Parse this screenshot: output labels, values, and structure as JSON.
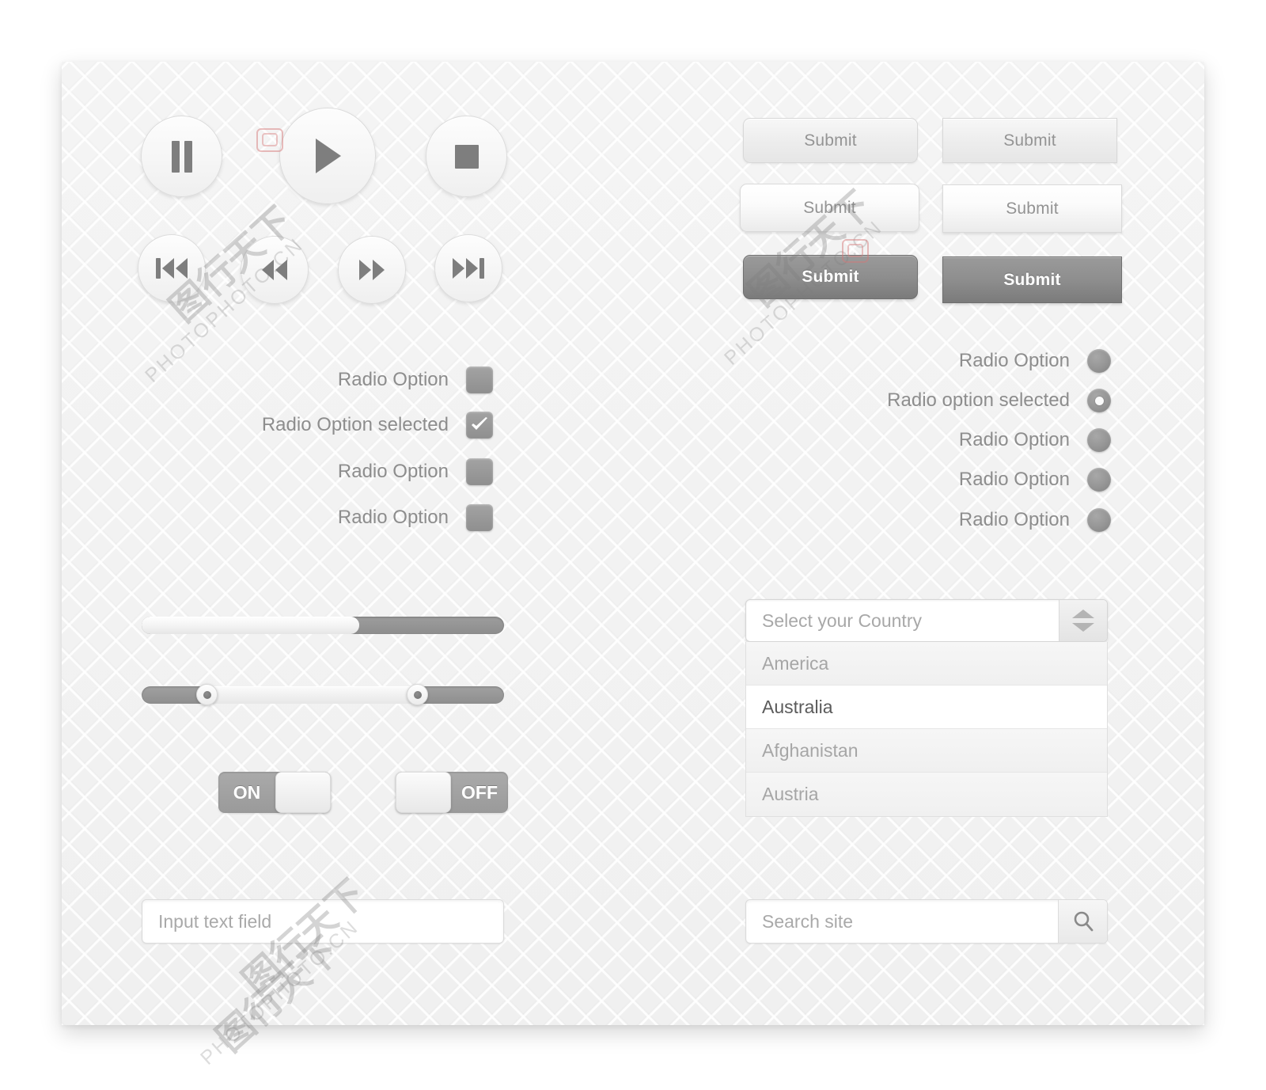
{
  "panel": {
    "background_color": "#f1f1f1",
    "accent_gray": "#8e8e8e",
    "text_gray": "#8d8d8d"
  },
  "media_controls": {
    "buttons": [
      {
        "name": "pause-button",
        "icon": "pause-icon"
      },
      {
        "name": "play-button",
        "icon": "play-icon"
      },
      {
        "name": "stop-button",
        "icon": "stop-icon"
      },
      {
        "name": "skip-back-button",
        "icon": "skip-back-icon"
      },
      {
        "name": "rewind-button",
        "icon": "rewind-icon"
      },
      {
        "name": "fast-forward-button",
        "icon": "fast-forward-icon"
      },
      {
        "name": "skip-forward-button",
        "icon": "skip-forward-icon"
      }
    ]
  },
  "submit_buttons": [
    {
      "label": "Submit",
      "style": "light-flat",
      "shape": "rounded"
    },
    {
      "label": "Submit",
      "style": "light-flat",
      "shape": "square"
    },
    {
      "label": "Submit",
      "style": "light-glossy",
      "shape": "rounded"
    },
    {
      "label": "Submit",
      "style": "light-glossy",
      "shape": "square"
    },
    {
      "label": "Submit",
      "style": "dark",
      "shape": "rounded"
    },
    {
      "label": "Submit",
      "style": "dark",
      "shape": "square"
    }
  ],
  "checkbox_group": {
    "items": [
      {
        "label": "Radio Option",
        "checked": false
      },
      {
        "label": "Radio Option selected",
        "checked": true
      },
      {
        "label": "Radio Option",
        "checked": false
      },
      {
        "label": "Radio Option",
        "checked": false
      }
    ]
  },
  "radio_group": {
    "items": [
      {
        "label": "Radio Option",
        "selected": false
      },
      {
        "label": "Radio option selected",
        "selected": true
      },
      {
        "label": "Radio Option",
        "selected": false
      },
      {
        "label": "Radio Option",
        "selected": false
      },
      {
        "label": "Radio Option",
        "selected": false
      }
    ]
  },
  "progress_bar": {
    "percent": 60
  },
  "range_slider": {
    "low_percent": 18,
    "high_percent": 76
  },
  "toggles": [
    {
      "label": "ON",
      "state": "on",
      "knob_side": "right"
    },
    {
      "label": "OFF",
      "state": "off",
      "knob_side": "left"
    }
  ],
  "text_input": {
    "placeholder": "Input text field",
    "value": ""
  },
  "search": {
    "placeholder": "Search site",
    "value": "",
    "icon": "search-icon"
  },
  "select": {
    "placeholder": "Select your Country",
    "value": "",
    "stepper_icon": "stepper-updown-icon",
    "options": [
      {
        "label": "America",
        "selected": false
      },
      {
        "label": "Australia",
        "selected": true
      },
      {
        "label": "Afghanistan",
        "selected": false
      },
      {
        "label": "Austria",
        "selected": false
      }
    ]
  },
  "watermarks": {
    "site": "PHOTOPHOTO.CN",
    "cn": "图行天下"
  }
}
